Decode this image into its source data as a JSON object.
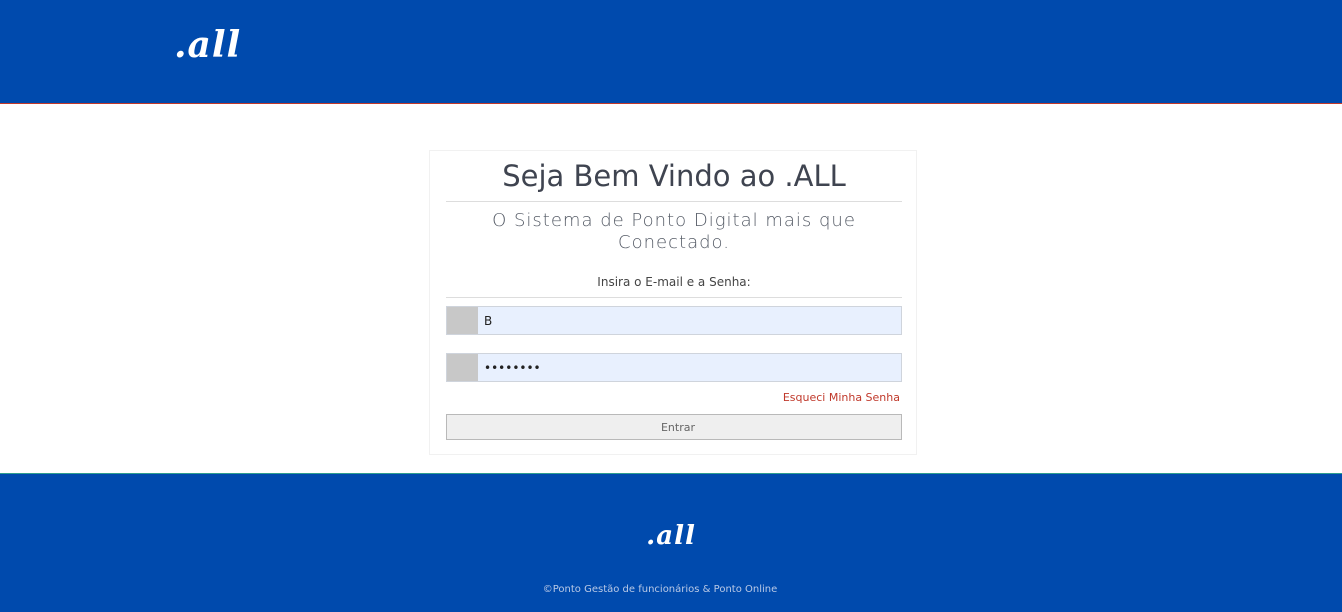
{
  "header": {
    "logo": ".all"
  },
  "login": {
    "title": "Seja Bem Vindo ao .ALL",
    "subtitle": "O Sistema de Ponto Digital mais que Conectado.",
    "instruction": "Insira o E-mail e a Senha:",
    "email_icon": "user-icon",
    "email_icon_glyph": "",
    "email_value": "B",
    "password_icon": "lock-icon",
    "password_icon_glyph": "",
    "password_value": "••••••••",
    "forgot_icon_glyph": "",
    "forgot_label": "Esqueci Minha Senha",
    "submit_icon_glyph": "",
    "submit_label": "Entrar"
  },
  "footer": {
    "logo": ".all",
    "copyright": "©Ponto Gestão de funcionários & Ponto Online"
  },
  "colors": {
    "brand_blue": "#004aad",
    "forgot_red": "#c0392b",
    "input_bg": "#e8f0fe"
  }
}
